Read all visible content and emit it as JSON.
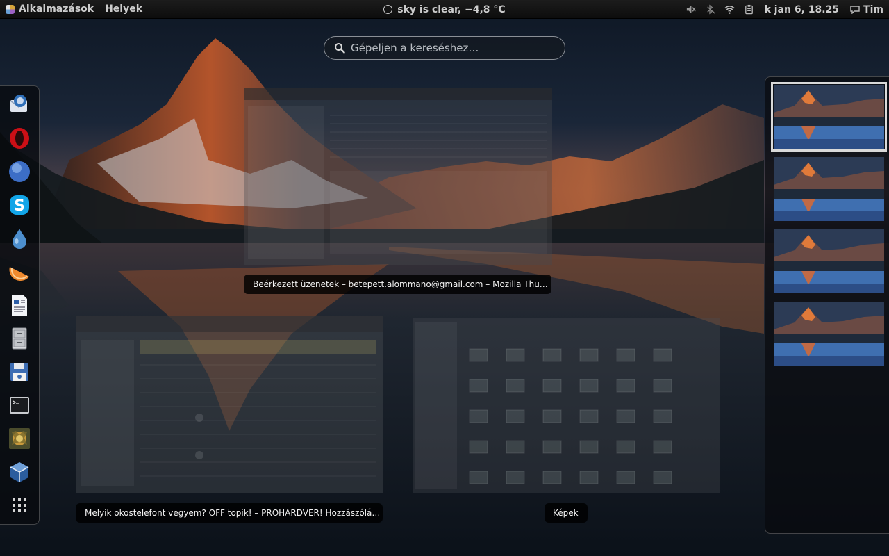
{
  "top_panel": {
    "applications": "Alkalmazások",
    "places": "Helyek",
    "weather": "sky is clear, −4,8 °C",
    "clock": "k jan  6, 18.25",
    "user": "Tim"
  },
  "search": {
    "placeholder": "Gépeljen a kereséshez…"
  },
  "dash": {
    "items": [
      {
        "name": "thunderbird",
        "icon": "thunderbird-icon"
      },
      {
        "name": "opera",
        "icon": "opera-icon"
      },
      {
        "name": "browser",
        "icon": "globe-icon"
      },
      {
        "name": "skype",
        "icon": "skype-icon"
      },
      {
        "name": "water-drop-app",
        "icon": "drop-icon"
      },
      {
        "name": "fruit-app",
        "icon": "orange-slice-icon"
      },
      {
        "name": "text-editor",
        "icon": "document-icon"
      },
      {
        "name": "file-manager",
        "icon": "file-cabinet-icon"
      },
      {
        "name": "backup",
        "icon": "floppy-icon"
      },
      {
        "name": "terminal",
        "icon": "terminal-icon"
      },
      {
        "name": "game",
        "icon": "game-icon"
      },
      {
        "name": "virtualbox",
        "icon": "cube-icon"
      },
      {
        "name": "show-applications",
        "icon": "grid-icon"
      }
    ]
  },
  "windows": [
    {
      "caption": "Beérkezett üzenetek – betepett.alommano@gmail.com – Mozilla Thu…"
    },
    {
      "caption": "Melyik okostelefont vegyem? OFF topik! – PROHARDVER! Hozzászólá…"
    },
    {
      "caption": "Képek"
    }
  ],
  "workspaces": {
    "count": 4,
    "active_index": 0
  },
  "colors": {
    "panel": "#111111",
    "caption_bg": "#000000",
    "active_outline": "#d9d9d9"
  }
}
